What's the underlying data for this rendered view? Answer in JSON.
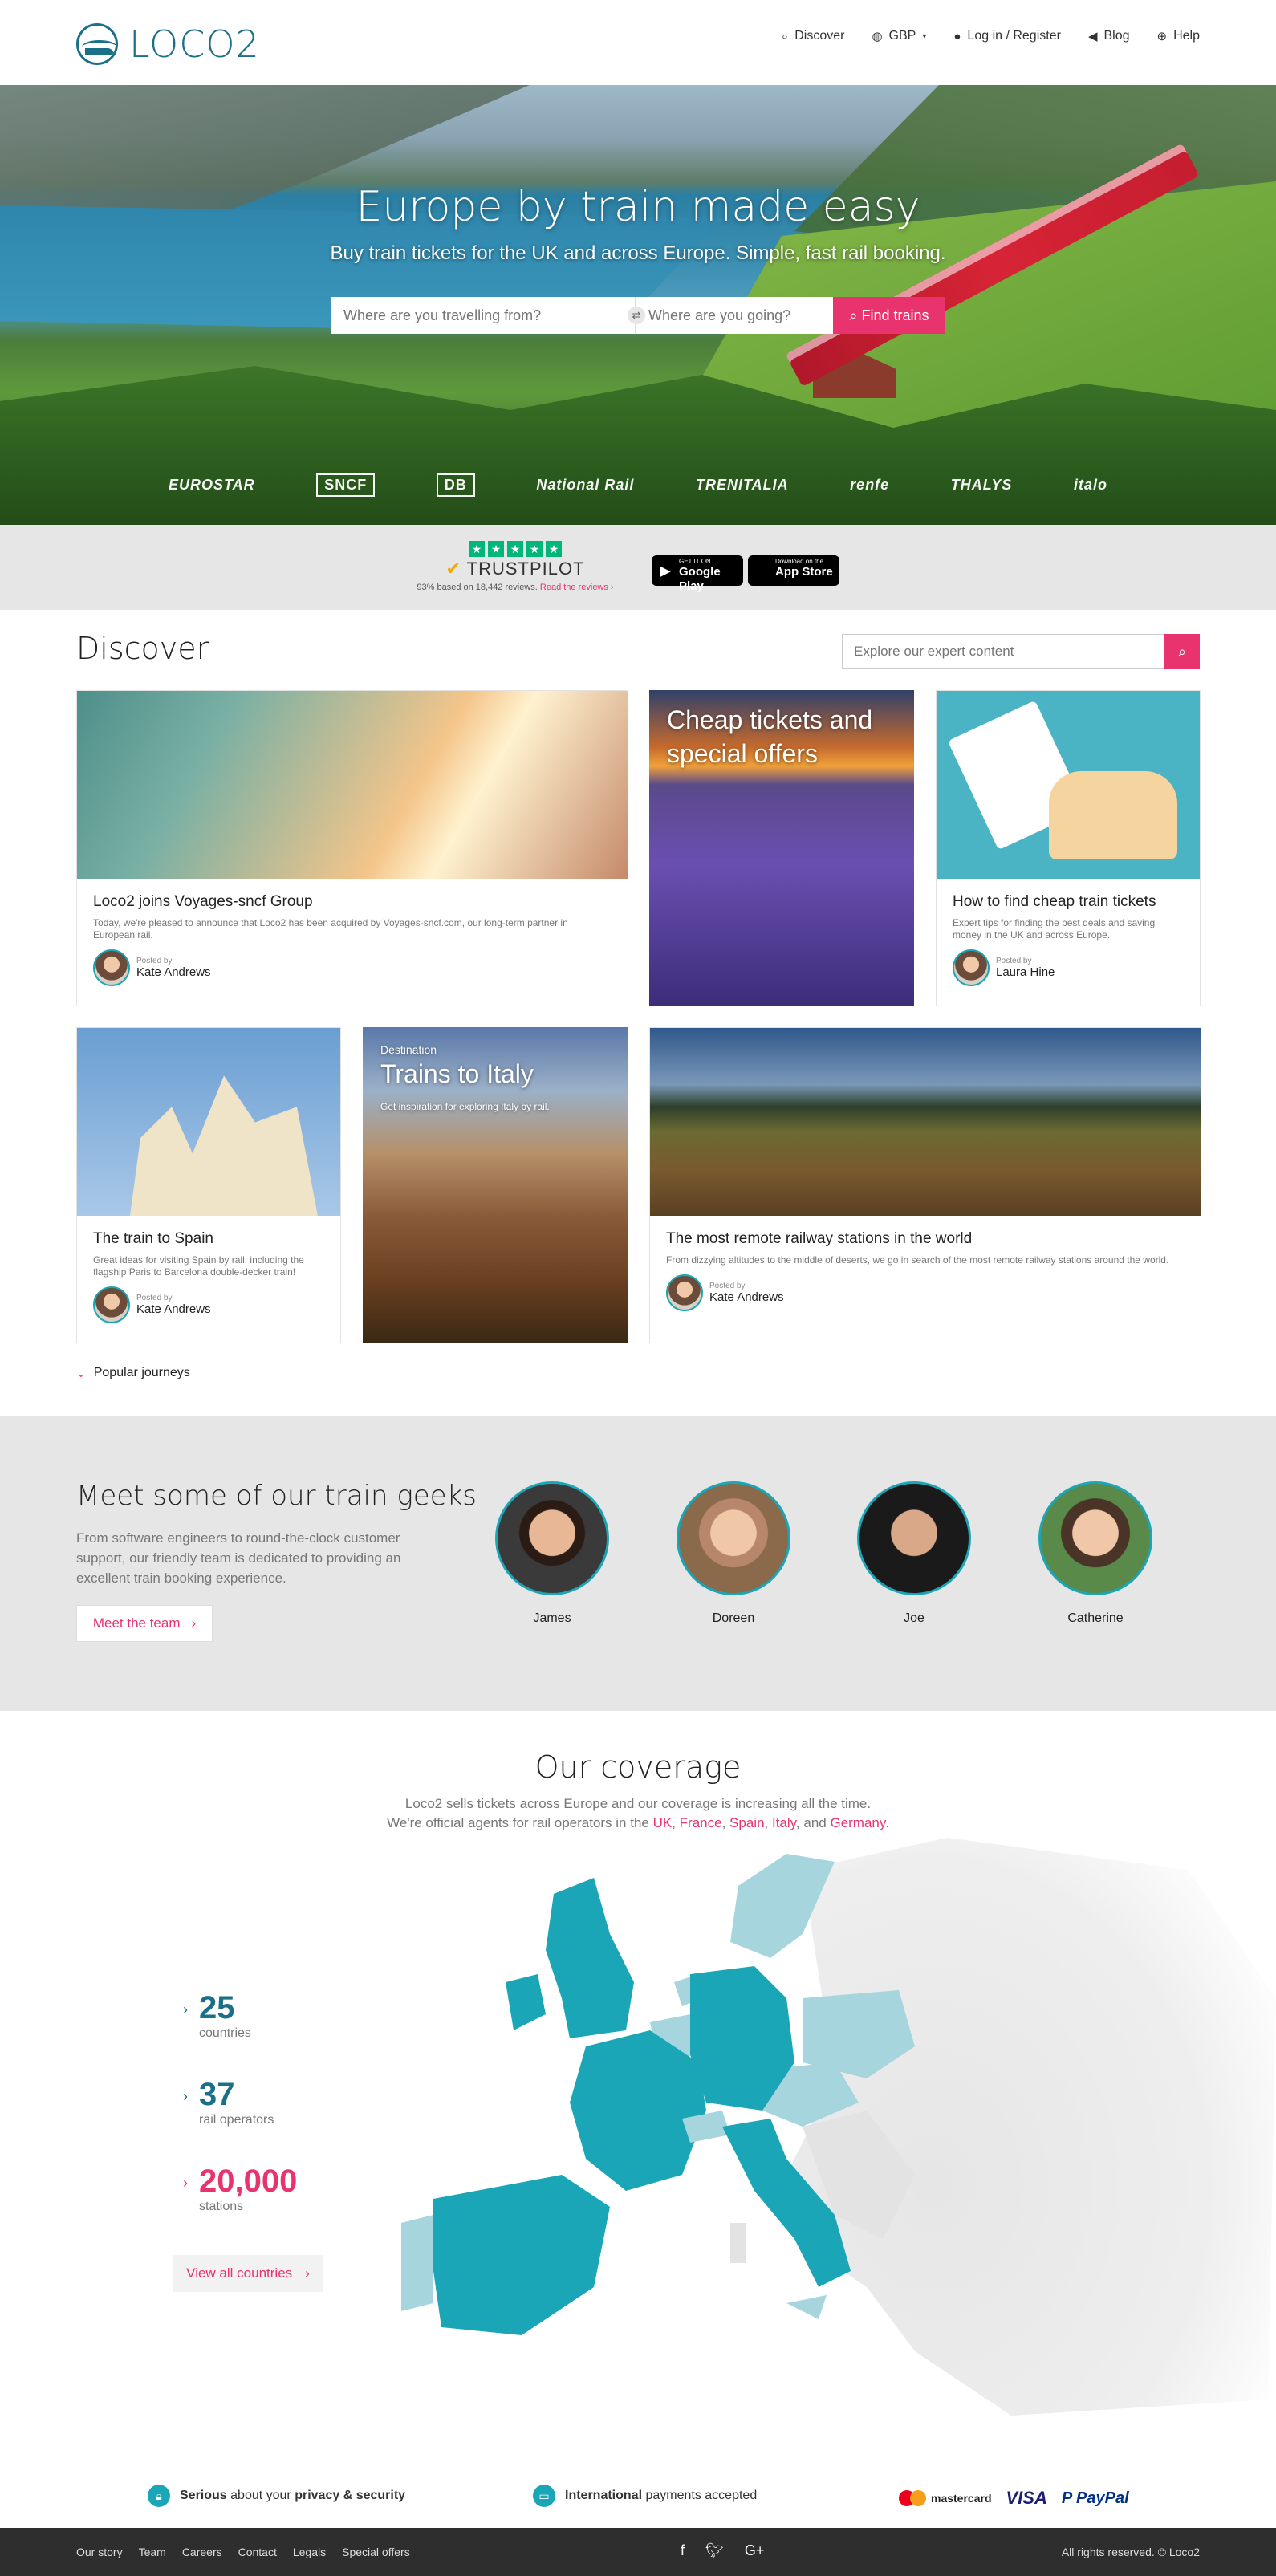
{
  "header": {
    "logo_text": "LOCO2",
    "nav": [
      {
        "icon": "search-icon",
        "label": "Discover"
      },
      {
        "icon": "globe-icon",
        "label": "GBP"
      },
      {
        "icon": "user-icon",
        "label": "Log in / Register"
      },
      {
        "icon": "megaphone-icon",
        "label": "Blog"
      },
      {
        "icon": "lifebuoy-icon",
        "label": "Help"
      }
    ]
  },
  "hero": {
    "title": "Europe by train made easy",
    "subtitle": "Buy train tickets for the UK and across Europe. Simple, fast rail booking.",
    "from_placeholder": "Where are you travelling from?",
    "to_placeholder": "Where are you going?",
    "find_label": "Find trains",
    "operators": [
      "EUROSTAR",
      "SNCF",
      "DB",
      "National Rail",
      "TRENITALIA",
      "renfe",
      "THALYS",
      "italo"
    ]
  },
  "trust": {
    "brand": "TRUSTPILOT",
    "meta": "93% based on 18,442 reviews.",
    "link": "Read the reviews ›",
    "google_small": "GET IT ON",
    "google_big": "Google Play",
    "apple_small": "Download on the",
    "apple_big": "App Store"
  },
  "discover": {
    "title": "Discover",
    "search_placeholder": "Explore our expert content",
    "cards": [
      {
        "title": "Loco2 joins Voyages-sncf Group",
        "text": "Today, we're pleased to announce that Loco2 has been acquired by Voyages-sncf.com, our long-term partner in European rail.",
        "posted": "Posted by",
        "author": "Kate Andrews"
      },
      {
        "overlay": "Cheap tickets and special offers"
      },
      {
        "title": "How to find cheap train tickets",
        "text": "Expert tips for finding the best deals and saving money in the UK and across Europe.",
        "posted": "Posted by",
        "author": "Laura Hine"
      },
      {
        "title": "The train to Spain",
        "text": "Great ideas for visiting Spain by rail, including the flagship Paris to Barcelona double-decker train!",
        "posted": "Posted by",
        "author": "Kate Andrews"
      },
      {
        "kicker": "Destination",
        "overlay": "Trains to Italy",
        "overlay_sub": "Get inspiration for exploring Italy by rail."
      },
      {
        "title": "The most remote railway stations in the world",
        "text": "From dizzying altitudes to the middle of deserts, we go in search of the most remote railway stations around the world.",
        "posted": "Posted by",
        "author": "Kate Andrews"
      }
    ],
    "popular": "Popular journeys"
  },
  "geeks": {
    "title": "Meet some of our train geeks",
    "desc": "From software engineers to round-the-clock customer support, our friendly team is dedicated to providing an excellent train booking experience.",
    "button": "Meet the team",
    "people": [
      "James",
      "Doreen",
      "Joe",
      "Catherine"
    ]
  },
  "coverage": {
    "title": "Our coverage",
    "line1": "Loco2 sells tickets across Europe and our coverage is increasing all the time.",
    "line2_prefix": "We're official agents for rail operators in the ",
    "countries": [
      "UK",
      "France",
      "Spain",
      "Italy"
    ],
    "and": "and",
    "last_country": "Germany",
    "stats": [
      {
        "num": "25",
        "label": "countries"
      },
      {
        "num": "37",
        "label": "rail operators"
      },
      {
        "num": "20,000",
        "label": "stations"
      }
    ],
    "button": "View all countries"
  },
  "security": {
    "a_bold": "Serious",
    "a_mid": "about your",
    "a_bold2": "privacy & security",
    "b_bold": "International",
    "b_rest": "payments accepted",
    "mastercard": "mastercard",
    "visa": "VISA",
    "paypal": "PayPal"
  },
  "footer": {
    "links": [
      "Our story",
      "Team",
      "Careers",
      "Contact",
      "Legals",
      "Special offers"
    ],
    "rights": "All rights reserved. © Loco2"
  },
  "colors": {
    "accent": "#e9336f",
    "teal": "#1aa6b7",
    "brand": "#1b6f86"
  }
}
